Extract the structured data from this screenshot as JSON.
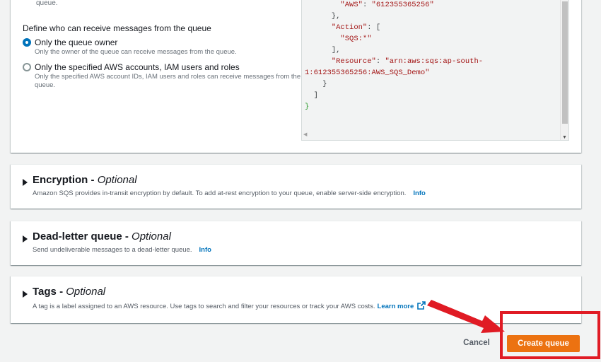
{
  "policy": {
    "truncated_text": "queue.",
    "define_label": "Define who can receive messages from the queue",
    "options": [
      {
        "title": "Only the queue owner",
        "desc": "Only the owner of the queue can receive messages from the queue.",
        "checked": true
      },
      {
        "title": "Only the specified AWS accounts, IAM users and roles",
        "desc": "Only the specified AWS account IDs, IAM users and roles can receive messages from the queue.",
        "checked": false
      }
    ],
    "code": {
      "aws_key": "\"AWS\"",
      "aws_val": "\"612355365256\"",
      "close_brace1": "},",
      "action_key": "\"Action\"",
      "action_val": "\"SQS:*\"",
      "close_bracket1": "],",
      "resource_key": "\"Resource\"",
      "resource_val1": "\"arn:aws:sqs:ap-south-",
      "resource_val2": "1:612355365256:AWS_SQS_Demo\"",
      "close_brace2": "}",
      "close_bracket2": "]",
      "close_brace3": "}"
    }
  },
  "sections": {
    "encryption": {
      "title": "Encryption",
      "optional": "Optional",
      "desc": "Amazon SQS provides in-transit encryption by default. To add at-rest encryption to your queue, enable server-side encryption.",
      "link": "Info"
    },
    "dlq": {
      "title": "Dead-letter queue",
      "optional": "Optional",
      "desc": "Send undeliverable messages to a dead-letter queue.",
      "link": "Info"
    },
    "tags": {
      "title": "Tags",
      "optional": "Optional",
      "desc": "A tag is a label assigned to an AWS resource. Use tags to search and filter your resources or track your AWS costs.",
      "link": "Learn more"
    }
  },
  "footer": {
    "cancel_label": "Cancel",
    "create_label": "Create queue"
  },
  "colors": {
    "primary_button": "#ec7211",
    "link": "#0073bb",
    "highlight": "#e01b24"
  }
}
